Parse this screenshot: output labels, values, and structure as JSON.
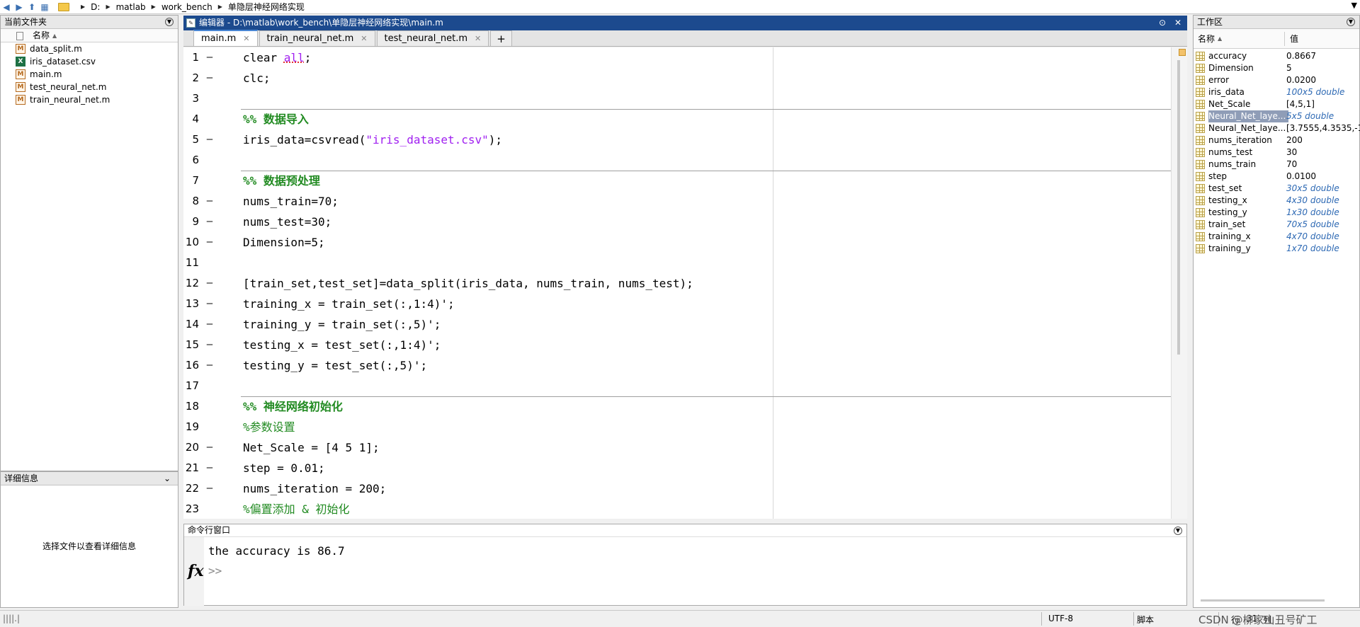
{
  "address_bar": {
    "path": [
      "D:",
      "matlab",
      "work_bench",
      "单隐层神经网络实现"
    ]
  },
  "current_folder": {
    "title": "当前文件夹",
    "column_name": "名称",
    "files": [
      {
        "name": "data_split.m",
        "icon": "m-file-icon"
      },
      {
        "name": "iris_dataset.csv",
        "icon": "csv-file-icon"
      },
      {
        "name": "main.m",
        "icon": "m-file-icon"
      },
      {
        "name": "test_neural_net.m",
        "icon": "m-file-icon"
      },
      {
        "name": "train_neural_net.m",
        "icon": "m-file-icon"
      }
    ]
  },
  "details": {
    "title": "详细信息",
    "placeholder": "选择文件以查看详细信息"
  },
  "editor": {
    "title": "编辑器 - D:\\matlab\\work_bench\\单隐层神经网络实现\\main.m",
    "tabs": [
      "main.m",
      "train_neural_net.m",
      "test_neural_net.m"
    ],
    "plus": "+",
    "line_numbers": [
      "1",
      "2",
      "3",
      "4",
      "5",
      "6",
      "7",
      "8",
      "9",
      "10",
      "11",
      "12",
      "13",
      "14",
      "15",
      "16",
      "17",
      "18",
      "19",
      "20",
      "21",
      "22",
      "23"
    ]
  },
  "command_window": {
    "title": "命令行窗口",
    "output": "the accuracy is 86.7",
    "fx": "fx",
    "prompt": ">>"
  },
  "workspace": {
    "title": "工作区",
    "col_name": "名称",
    "col_value": "值",
    "vars": [
      {
        "name": "accuracy",
        "value": "0.8667"
      },
      {
        "name": "Dimension",
        "value": "5"
      },
      {
        "name": "error",
        "value": "0.0200"
      },
      {
        "name": "iris_data",
        "value": "100x5 double"
      },
      {
        "name": "Net_Scale",
        "value": "[4,5,1]"
      },
      {
        "name": "Neural_Net_laye...",
        "value": "5x5 double"
      },
      {
        "name": "Neural_Net_laye...",
        "value": "[3.7555,4.3535,-1"
      },
      {
        "name": "nums_iteration",
        "value": "200"
      },
      {
        "name": "nums_test",
        "value": "30"
      },
      {
        "name": "nums_train",
        "value": "70"
      },
      {
        "name": "step",
        "value": "0.0100"
      },
      {
        "name": "test_set",
        "value": "30x5 double"
      },
      {
        "name": "testing_x",
        "value": "4x30 double"
      },
      {
        "name": "testing_y",
        "value": "1x30 double"
      },
      {
        "name": "train_set",
        "value": "70x5 double"
      },
      {
        "name": "training_x",
        "value": "4x70 double"
      },
      {
        "name": "training_y",
        "value": "1x70 double"
      }
    ]
  },
  "status_bar": {
    "encoding": "UTF-8",
    "type": "脚本",
    "row_label": "行",
    "row": "31",
    "col_label": "列",
    "watermark": "CSDN @柳家山丑号矿工"
  }
}
